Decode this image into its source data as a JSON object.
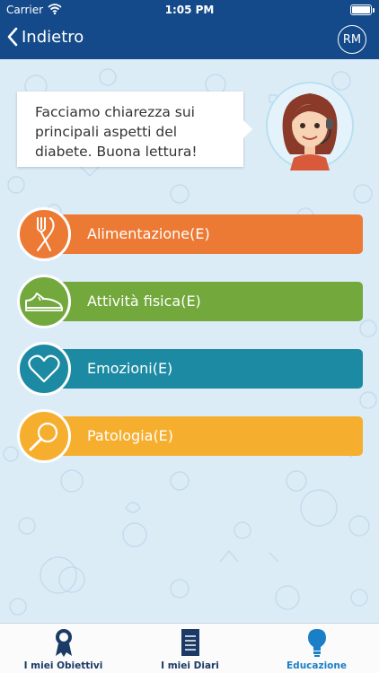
{
  "status_bar": {
    "carrier": "Carrier",
    "time": "1:05 PM"
  },
  "nav": {
    "back_label": "Indietro",
    "user_initials": "RM"
  },
  "assistant": {
    "message": "Facciamo chiarezza sui principali aspetti del diabete. Buona lettura!"
  },
  "categories": [
    {
      "label": "Alimentazione(E)",
      "icon": "fork-knife-icon",
      "color": "#ec7a34"
    },
    {
      "label": "Attività fisica(E)",
      "icon": "sneaker-icon",
      "color": "#72a83c"
    },
    {
      "label": "Emozioni(E)",
      "icon": "heart-icon",
      "color": "#1d8aa3"
    },
    {
      "label": "Patologia(E)",
      "icon": "magnifier-icon",
      "color": "#f6ae2e"
    }
  ],
  "tabs": [
    {
      "label": "I miei Obiettivi",
      "icon": "ribbon-icon"
    },
    {
      "label": "I miei Diari",
      "icon": "notebook-icon"
    },
    {
      "label": "Educazione",
      "icon": "lightbulb-icon",
      "active": true
    }
  ]
}
